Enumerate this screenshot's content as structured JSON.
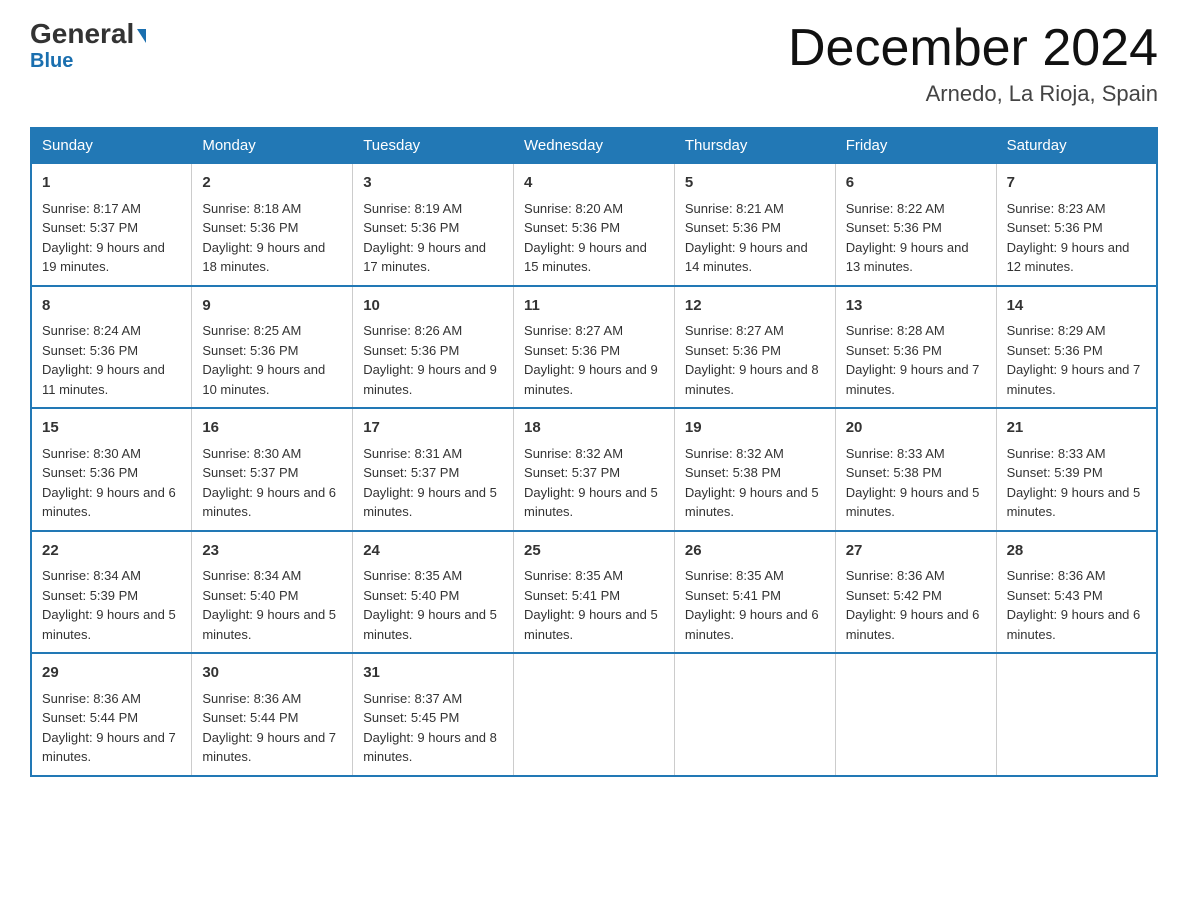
{
  "header": {
    "logo_general": "General",
    "logo_blue": "Blue",
    "title": "December 2024",
    "subtitle": "Arnedo, La Rioja, Spain"
  },
  "days": [
    "Sunday",
    "Monday",
    "Tuesday",
    "Wednesday",
    "Thursday",
    "Friday",
    "Saturday"
  ],
  "weeks": [
    [
      {
        "num": "1",
        "sunrise": "8:17 AM",
        "sunset": "5:37 PM",
        "daylight": "9 hours and 19 minutes."
      },
      {
        "num": "2",
        "sunrise": "8:18 AM",
        "sunset": "5:36 PM",
        "daylight": "9 hours and 18 minutes."
      },
      {
        "num": "3",
        "sunrise": "8:19 AM",
        "sunset": "5:36 PM",
        "daylight": "9 hours and 17 minutes."
      },
      {
        "num": "4",
        "sunrise": "8:20 AM",
        "sunset": "5:36 PM",
        "daylight": "9 hours and 15 minutes."
      },
      {
        "num": "5",
        "sunrise": "8:21 AM",
        "sunset": "5:36 PM",
        "daylight": "9 hours and 14 minutes."
      },
      {
        "num": "6",
        "sunrise": "8:22 AM",
        "sunset": "5:36 PM",
        "daylight": "9 hours and 13 minutes."
      },
      {
        "num": "7",
        "sunrise": "8:23 AM",
        "sunset": "5:36 PM",
        "daylight": "9 hours and 12 minutes."
      }
    ],
    [
      {
        "num": "8",
        "sunrise": "8:24 AM",
        "sunset": "5:36 PM",
        "daylight": "9 hours and 11 minutes."
      },
      {
        "num": "9",
        "sunrise": "8:25 AM",
        "sunset": "5:36 PM",
        "daylight": "9 hours and 10 minutes."
      },
      {
        "num": "10",
        "sunrise": "8:26 AM",
        "sunset": "5:36 PM",
        "daylight": "9 hours and 9 minutes."
      },
      {
        "num": "11",
        "sunrise": "8:27 AM",
        "sunset": "5:36 PM",
        "daylight": "9 hours and 9 minutes."
      },
      {
        "num": "12",
        "sunrise": "8:27 AM",
        "sunset": "5:36 PM",
        "daylight": "9 hours and 8 minutes."
      },
      {
        "num": "13",
        "sunrise": "8:28 AM",
        "sunset": "5:36 PM",
        "daylight": "9 hours and 7 minutes."
      },
      {
        "num": "14",
        "sunrise": "8:29 AM",
        "sunset": "5:36 PM",
        "daylight": "9 hours and 7 minutes."
      }
    ],
    [
      {
        "num": "15",
        "sunrise": "8:30 AM",
        "sunset": "5:36 PM",
        "daylight": "9 hours and 6 minutes."
      },
      {
        "num": "16",
        "sunrise": "8:30 AM",
        "sunset": "5:37 PM",
        "daylight": "9 hours and 6 minutes."
      },
      {
        "num": "17",
        "sunrise": "8:31 AM",
        "sunset": "5:37 PM",
        "daylight": "9 hours and 5 minutes."
      },
      {
        "num": "18",
        "sunrise": "8:32 AM",
        "sunset": "5:37 PM",
        "daylight": "9 hours and 5 minutes."
      },
      {
        "num": "19",
        "sunrise": "8:32 AM",
        "sunset": "5:38 PM",
        "daylight": "9 hours and 5 minutes."
      },
      {
        "num": "20",
        "sunrise": "8:33 AM",
        "sunset": "5:38 PM",
        "daylight": "9 hours and 5 minutes."
      },
      {
        "num": "21",
        "sunrise": "8:33 AM",
        "sunset": "5:39 PM",
        "daylight": "9 hours and 5 minutes."
      }
    ],
    [
      {
        "num": "22",
        "sunrise": "8:34 AM",
        "sunset": "5:39 PM",
        "daylight": "9 hours and 5 minutes."
      },
      {
        "num": "23",
        "sunrise": "8:34 AM",
        "sunset": "5:40 PM",
        "daylight": "9 hours and 5 minutes."
      },
      {
        "num": "24",
        "sunrise": "8:35 AM",
        "sunset": "5:40 PM",
        "daylight": "9 hours and 5 minutes."
      },
      {
        "num": "25",
        "sunrise": "8:35 AM",
        "sunset": "5:41 PM",
        "daylight": "9 hours and 5 minutes."
      },
      {
        "num": "26",
        "sunrise": "8:35 AM",
        "sunset": "5:41 PM",
        "daylight": "9 hours and 6 minutes."
      },
      {
        "num": "27",
        "sunrise": "8:36 AM",
        "sunset": "5:42 PM",
        "daylight": "9 hours and 6 minutes."
      },
      {
        "num": "28",
        "sunrise": "8:36 AM",
        "sunset": "5:43 PM",
        "daylight": "9 hours and 6 minutes."
      }
    ],
    [
      {
        "num": "29",
        "sunrise": "8:36 AM",
        "sunset": "5:44 PM",
        "daylight": "9 hours and 7 minutes."
      },
      {
        "num": "30",
        "sunrise": "8:36 AM",
        "sunset": "5:44 PM",
        "daylight": "9 hours and 7 minutes."
      },
      {
        "num": "31",
        "sunrise": "8:37 AM",
        "sunset": "5:45 PM",
        "daylight": "9 hours and 8 minutes."
      },
      null,
      null,
      null,
      null
    ]
  ]
}
